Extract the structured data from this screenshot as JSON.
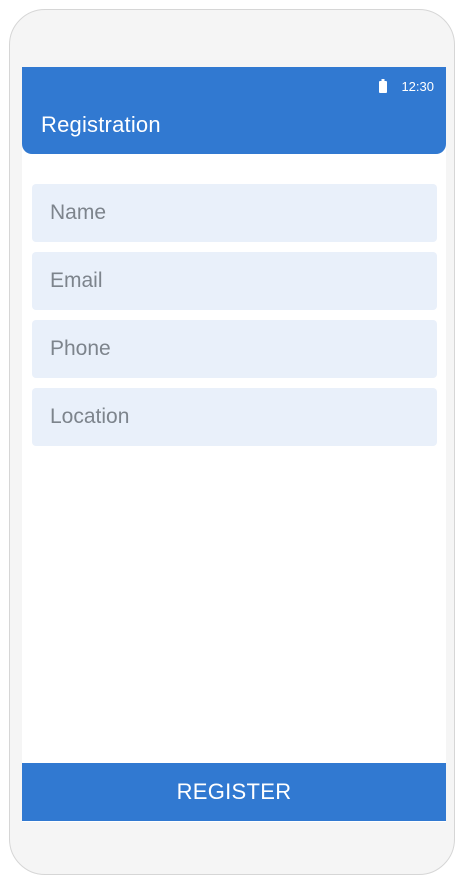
{
  "status_bar": {
    "time": "12:30",
    "battery_icon": "battery-icon"
  },
  "app_bar": {
    "title": "Registration"
  },
  "form": {
    "fields": [
      {
        "placeholder": "Name",
        "value": ""
      },
      {
        "placeholder": "Email",
        "value": ""
      },
      {
        "placeholder": "Phone",
        "value": ""
      },
      {
        "placeholder": "Location",
        "value": ""
      }
    ]
  },
  "actions": {
    "register_label": "REGISTER"
  },
  "colors": {
    "primary": "#3179d1",
    "field_background": "#e9f0fa",
    "placeholder_text": "#7d848c"
  }
}
